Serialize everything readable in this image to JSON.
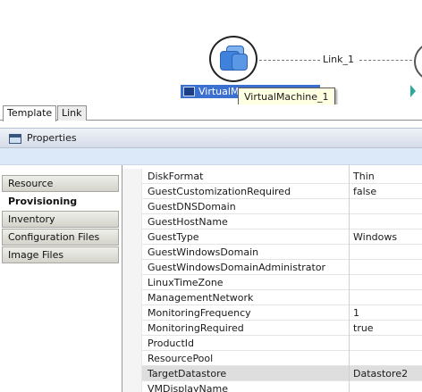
{
  "canvas": {
    "vm_label": "VirtualM",
    "tooltip": "VirtualMachine_1",
    "link_label": "Link_1"
  },
  "tabs": [
    {
      "label": "Template",
      "active": true
    },
    {
      "label": "Link",
      "active": false
    }
  ],
  "properties": {
    "title": "Properties",
    "side_tabs": [
      {
        "label": "Resource",
        "active": false
      },
      {
        "label": "Provisioning",
        "active": true
      },
      {
        "label": "Inventory",
        "active": false
      },
      {
        "label": "Configuration Files",
        "active": false
      },
      {
        "label": "Image Files",
        "active": false
      }
    ],
    "rows": [
      {
        "name": "DiskFormat",
        "value": "Thin"
      },
      {
        "name": "GuestCustomizationRequired",
        "value": "false"
      },
      {
        "name": "GuestDNSDomain",
        "value": ""
      },
      {
        "name": "GuestHostName",
        "value": ""
      },
      {
        "name": "GuestType",
        "value": "Windows"
      },
      {
        "name": "GuestWindowsDomain",
        "value": ""
      },
      {
        "name": "GuestWindowsDomainAdministrator",
        "value": ""
      },
      {
        "name": "LinuxTimeZone",
        "value": ""
      },
      {
        "name": "ManagementNetwork",
        "value": ""
      },
      {
        "name": "MonitoringFrequency",
        "value": "1"
      },
      {
        "name": "MonitoringRequired",
        "value": "true"
      },
      {
        "name": "ProductId",
        "value": ""
      },
      {
        "name": "ResourcePool",
        "value": ""
      },
      {
        "name": "TargetDatastore",
        "value": "Datastore2",
        "selected": true
      },
      {
        "name": "VMDisplayName",
        "value": ""
      }
    ]
  },
  "icons": {
    "vm_node": "virtual-machine-icon",
    "vm_label": "virtual-machine-small-icon",
    "properties": "properties-view-icon",
    "scroll": "scroll-right-arrow-icon"
  }
}
